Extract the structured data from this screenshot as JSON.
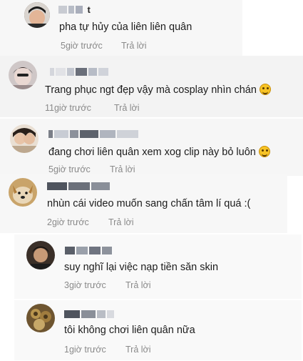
{
  "comments": [
    {
      "name_visible": "t",
      "text": "pha tự hủy của liên liên quân",
      "time": "5giờ trước",
      "reply": "Trả lời",
      "emoji": ""
    },
    {
      "name_visible": "",
      "text": "Trang phục ngt đẹp vậy mà cosplay nhìn chán",
      "time": "11giờ trước",
      "reply": "Trả lời",
      "emoji": "laughing-tears-emoji"
    },
    {
      "name_visible": "",
      "text": "đang chơi liên quân xem xog clip này bỏ luôn",
      "time": "5giờ trước",
      "reply": "Trả lời",
      "emoji": "smirk-emoji"
    },
    {
      "name_visible": "",
      "text": "nhùn cái video muốn sang chấn tâm lí quá :(",
      "time": "2giờ trước",
      "reply": "Trả lời",
      "emoji": ""
    },
    {
      "name_visible": "",
      "text": "suy nghĩ lại việc nạp tiền săn skin",
      "time": "3giờ trước",
      "reply": "Trả lời",
      "emoji": ""
    },
    {
      "name_visible": "",
      "text": "tôi không chơi liên quân nữa",
      "time": "1giờ trước",
      "reply": "Trả lời",
      "emoji": ""
    }
  ],
  "colors": {
    "meta": "#8a8a8a",
    "emoji": "#f7c325"
  }
}
